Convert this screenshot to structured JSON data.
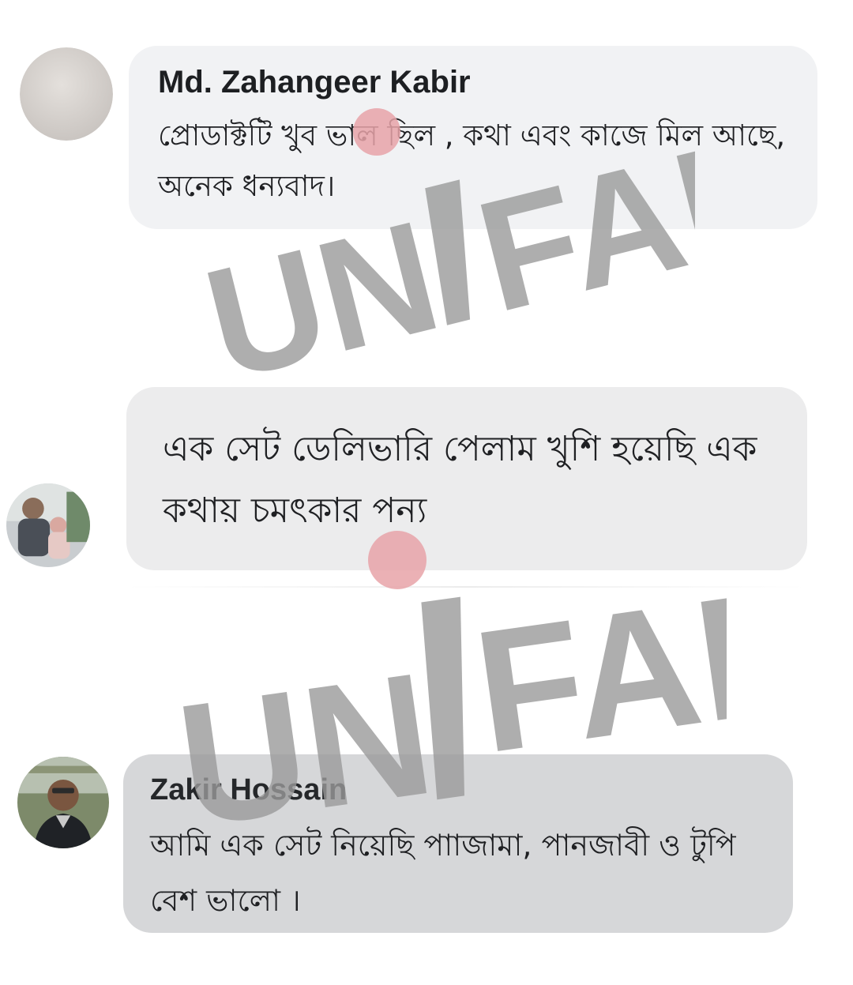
{
  "comments": [
    {
      "author": "Md. Zahangeer Kabir",
      "text": "প্রোডাক্টটি খুব ভাল ছিল , কথা এবং কাজে মিল আছে, অনেক ধন্যবাদ।"
    },
    {
      "author": "",
      "text": "এক সেট ডেলিভারি পেলাম খুশি হয়েছি এক কথায় চমৎকার পন্য"
    },
    {
      "author": "Zakir Hossain",
      "text": "আমি এক সেট নিয়েছি পাাজামা, পানজাবী ও টুপি  বেশ ভালো ।"
    }
  ],
  "watermark": {
    "text": "UNIFAB",
    "color": "#9a9a9a"
  },
  "colors": {
    "bubble_light": "#f1f2f4",
    "bubble_mid": "#ececed",
    "bubble_dark": "#d6d7d9",
    "author_text": "#1d1f22",
    "touch_dot": "#e8a3a8"
  }
}
